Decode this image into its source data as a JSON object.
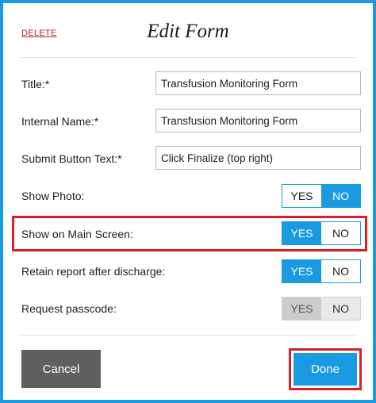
{
  "header": {
    "delete_label": "DELETE",
    "title": "Edit Form"
  },
  "fields": {
    "title": {
      "label": "Title:*",
      "value": "Transfusion Monitoring Form"
    },
    "internal_name": {
      "label": "Internal Name:*",
      "value": "Transfusion Monitoring Form"
    },
    "submit_text": {
      "label": "Submit Button Text:*",
      "value": "Click Finalize (top right)"
    }
  },
  "toggles": {
    "show_photo": {
      "label": "Show Photo:",
      "yes": "YES",
      "no": "NO",
      "selected": "NO"
    },
    "show_main": {
      "label": "Show on Main Screen:",
      "yes": "YES",
      "no": "NO",
      "selected": "YES"
    },
    "retain_report": {
      "label": "Retain report after discharge:",
      "yes": "YES",
      "no": "NO",
      "selected": "YES"
    },
    "request_passcode": {
      "label": "Request passcode:",
      "yes": "YES",
      "no": "NO",
      "selected": "YES",
      "disabled": true
    }
  },
  "actions": {
    "cancel_label": "Cancel",
    "done_label": "Done"
  },
  "colors": {
    "accent": "#1a9ae0",
    "highlight": "#d6202a",
    "delete": "#b0282e",
    "cancel_bg": "#5f5f5f"
  }
}
